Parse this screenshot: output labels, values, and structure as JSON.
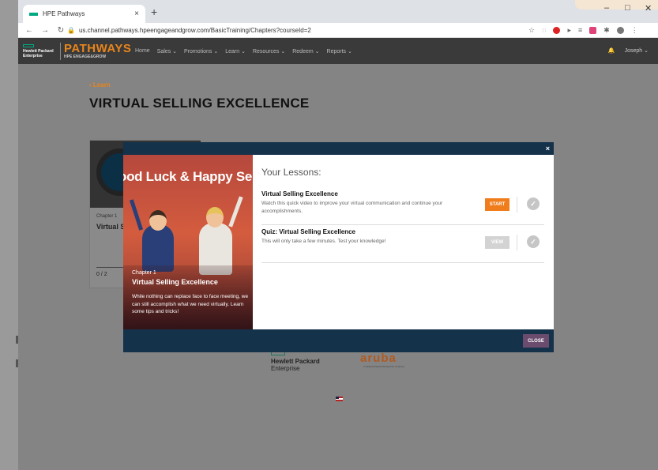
{
  "browser": {
    "tab_title": "HPE Pathways",
    "tab_close": "×",
    "new_tab": "+",
    "url": "us.channel.pathways.hpeengageandgrow.com/BasicTraining/Chapters?courseId=2",
    "win_min": "–",
    "win_max": "□",
    "win_close": "✕"
  },
  "header": {
    "hpe_line1": "Hewlett Packard",
    "hpe_line2": "Enterprise",
    "brand": "PATHWAYS",
    "brand_sub": "HPE ENGAGE&GROW",
    "nav": [
      "Home",
      "Sales ⌄",
      "Promotions ⌄",
      "Learn ⌄",
      "Resources ⌄",
      "Redeem ⌄",
      "Reports ⌄"
    ],
    "bell": "🔔",
    "user": "Joseph ⌄"
  },
  "page": {
    "back_link": "Learn",
    "title": "VIRTUAL SELLING EXCELLENCE",
    "card_chapter": "Chapter 1",
    "card_title": "Virtual S",
    "card_progress": "0 / 2"
  },
  "footer": {
    "hpe_line1": "Hewlett Packard",
    "hpe_line2": "Enterprise",
    "aruba": "aruba",
    "aruba_tag": "a Hewlett Packard Enterprise company"
  },
  "modal": {
    "close_x": "×",
    "banner": "ood Luck & Happy Selli",
    "chapter": "Chapter 1",
    "promo_title": "Virtual Selling Excellence",
    "promo_desc": "While nothing can replace face to face meeting, we can still accomplish what we need virtually. Learn some tips and tricks!",
    "lessons_heading": "Your Lessons:",
    "lessons": [
      {
        "title": "Virtual Selling Excellence",
        "desc": "Watch this quick video to improve your virtual communication and continue your accomplishments.",
        "button": "START"
      },
      {
        "title": "Quiz: Virtual Selling Excellence",
        "desc": "This will only take a few minutes. Test your knowledge!",
        "button": "VIEW"
      }
    ],
    "close_button": "CLOSE"
  }
}
